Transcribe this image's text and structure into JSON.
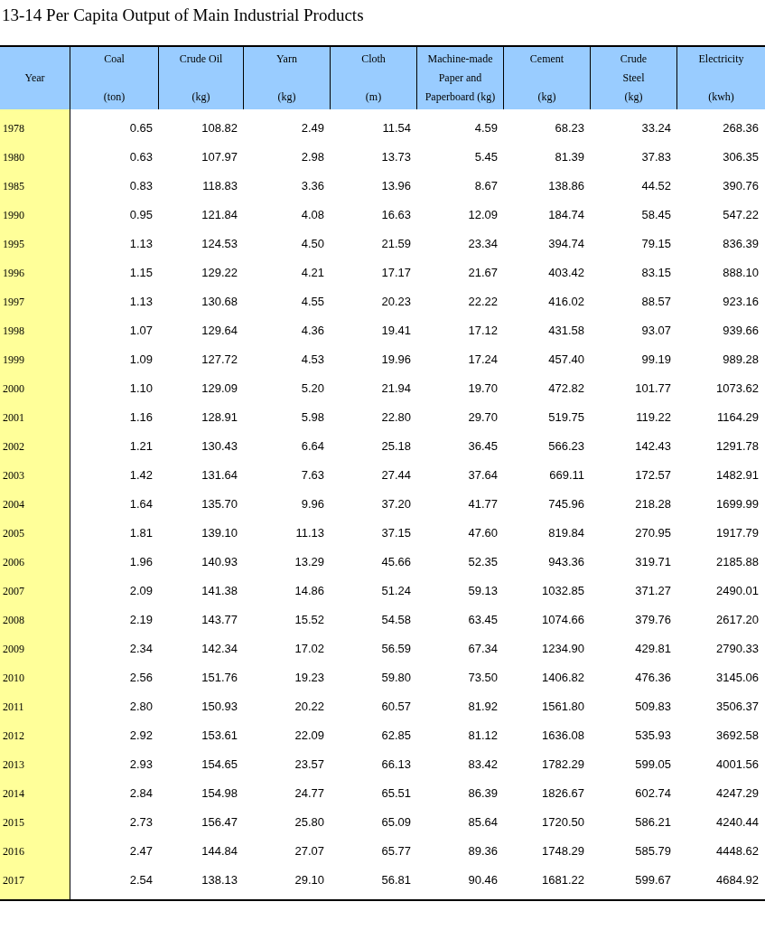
{
  "title": "13-14  Per Capita Output of Main Industrial Products",
  "table": {
    "columns": [
      {
        "lines": [
          "Year"
        ]
      },
      {
        "lines": [
          "Coal",
          "(ton)"
        ]
      },
      {
        "lines": [
          "Crude Oil",
          "(kg)"
        ]
      },
      {
        "lines": [
          "Yarn",
          "(kg)"
        ]
      },
      {
        "lines": [
          "Cloth",
          "(m)"
        ]
      },
      {
        "lines": [
          "Machine-made",
          "Paper and",
          "Paperboard (kg)"
        ]
      },
      {
        "lines": [
          "Cement",
          "(kg)"
        ]
      },
      {
        "lines": [
          "Crude",
          "Steel",
          "(kg)"
        ]
      },
      {
        "lines": [
          "Electricity",
          "(kwh)"
        ]
      }
    ],
    "rows": [
      [
        "1978",
        "0.65",
        "108.82",
        "2.49",
        "11.54",
        "4.59",
        "68.23",
        "33.24",
        "268.36"
      ],
      [
        "1980",
        "0.63",
        "107.97",
        "2.98",
        "13.73",
        "5.45",
        "81.39",
        "37.83",
        "306.35"
      ],
      [
        "1985",
        "0.83",
        "118.83",
        "3.36",
        "13.96",
        "8.67",
        "138.86",
        "44.52",
        "390.76"
      ],
      [
        "1990",
        "0.95",
        "121.84",
        "4.08",
        "16.63",
        "12.09",
        "184.74",
        "58.45",
        "547.22"
      ],
      [
        "1995",
        "1.13",
        "124.53",
        "4.50",
        "21.59",
        "23.34",
        "394.74",
        "79.15",
        "836.39"
      ],
      [
        "1996",
        "1.15",
        "129.22",
        "4.21",
        "17.17",
        "21.67",
        "403.42",
        "83.15",
        "888.10"
      ],
      [
        "1997",
        "1.13",
        "130.68",
        "4.55",
        "20.23",
        "22.22",
        "416.02",
        "88.57",
        "923.16"
      ],
      [
        "1998",
        "1.07",
        "129.64",
        "4.36",
        "19.41",
        "17.12",
        "431.58",
        "93.07",
        "939.66"
      ],
      [
        "1999",
        "1.09",
        "127.72",
        "4.53",
        "19.96",
        "17.24",
        "457.40",
        "99.19",
        "989.28"
      ],
      [
        "2000",
        "1.10",
        "129.09",
        "5.20",
        "21.94",
        "19.70",
        "472.82",
        "101.77",
        "1073.62"
      ],
      [
        "2001",
        "1.16",
        "128.91",
        "5.98",
        "22.80",
        "29.70",
        "519.75",
        "119.22",
        "1164.29"
      ],
      [
        "2002",
        "1.21",
        "130.43",
        "6.64",
        "25.18",
        "36.45",
        "566.23",
        "142.43",
        "1291.78"
      ],
      [
        "2003",
        "1.42",
        "131.64",
        "7.63",
        "27.44",
        "37.64",
        "669.11",
        "172.57",
        "1482.91"
      ],
      [
        "2004",
        "1.64",
        "135.70",
        "9.96",
        "37.20",
        "41.77",
        "745.96",
        "218.28",
        "1699.99"
      ],
      [
        "2005",
        "1.81",
        "139.10",
        "11.13",
        "37.15",
        "47.60",
        "819.84",
        "270.95",
        "1917.79"
      ],
      [
        "2006",
        "1.96",
        "140.93",
        "13.29",
        "45.66",
        "52.35",
        "943.36",
        "319.71",
        "2185.88"
      ],
      [
        "2007",
        "2.09",
        "141.38",
        "14.86",
        "51.24",
        "59.13",
        "1032.85",
        "371.27",
        "2490.01"
      ],
      [
        "2008",
        "2.19",
        "143.77",
        "15.52",
        "54.58",
        "63.45",
        "1074.66",
        "379.76",
        "2617.20"
      ],
      [
        "2009",
        "2.34",
        "142.34",
        "17.02",
        "56.59",
        "67.34",
        "1234.90",
        "429.81",
        "2790.33"
      ],
      [
        "2010",
        "2.56",
        "151.76",
        "19.23",
        "59.80",
        "73.50",
        "1406.82",
        "476.36",
        "3145.06"
      ],
      [
        "2011",
        "2.80",
        "150.93",
        "20.22",
        "60.57",
        "81.92",
        "1561.80",
        "509.83",
        "3506.37"
      ],
      [
        "2012",
        "2.92",
        "153.61",
        "22.09",
        "62.85",
        "81.12",
        "1636.08",
        "535.93",
        "3692.58"
      ],
      [
        "2013",
        "2.93",
        "154.65",
        "23.57",
        "66.13",
        "83.42",
        "1782.29",
        "599.05",
        "4001.56"
      ],
      [
        "2014",
        "2.84",
        "154.98",
        "24.77",
        "65.51",
        "86.39",
        "1826.67",
        "602.74",
        "4247.29"
      ],
      [
        "2015",
        "2.73",
        "156.47",
        "25.80",
        "65.09",
        "85.64",
        "1720.50",
        "586.21",
        "4240.44"
      ],
      [
        "2016",
        "2.47",
        "144.84",
        "27.07",
        "65.77",
        "89.36",
        "1748.29",
        "585.79",
        "4448.62"
      ],
      [
        "2017",
        "2.54",
        "138.13",
        "29.10",
        "56.81",
        "90.46",
        "1681.22",
        "599.67",
        "4684.92"
      ]
    ]
  }
}
